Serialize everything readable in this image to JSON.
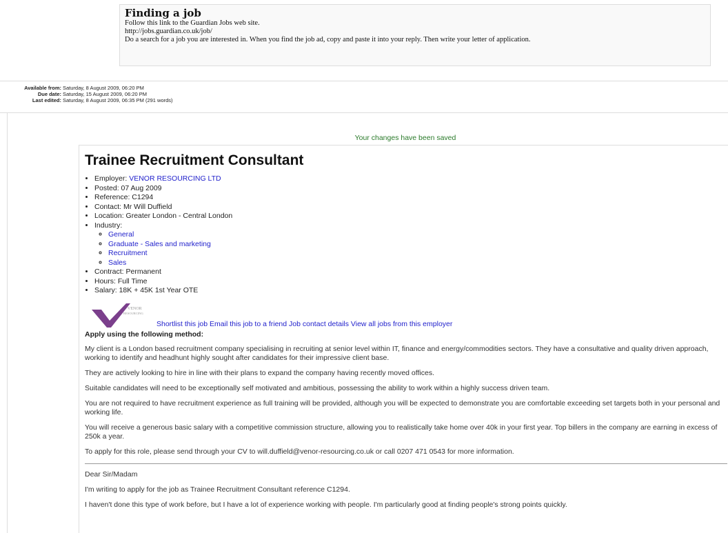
{
  "assignment": {
    "title": "Finding a job",
    "lines": [
      "Follow this link to the Guardian Jobs web site.",
      "http://jobs.guardian.co.uk/job/",
      "Do a search for a job you are interested in. When you find the job ad, copy and paste it into your reply. Then write your letter of application."
    ]
  },
  "dates": {
    "available_label": "Available from:",
    "available_value": "Saturday, 8 August 2009, 06:20 PM",
    "due_label": "Due date:",
    "due_value": "Saturday, 15 August 2009, 06:20 PM",
    "edited_label": "Last edited:",
    "edited_value": "Saturday, 8 August 2009, 06:35 PM (291 words)"
  },
  "status": {
    "saved": "Your changes have been saved"
  },
  "job": {
    "title": "Trainee Recruitment Consultant",
    "employer_label": "Employer: ",
    "employer": "VENOR RESOURCING LTD",
    "posted": "Posted: 07 Aug 2009",
    "reference": "Reference: C1294",
    "contact": "Contact: Mr Will Duffield",
    "location": "Location: Greater London - Central London",
    "industry_label": "Industry:",
    "industries": [
      "General",
      "Graduate - Sales and marketing",
      "Recruitment",
      "Sales"
    ],
    "contract": "Contract: Permanent",
    "hours": "Hours: Full Time",
    "salary": "Salary: 18K + 45K 1st Year OTE",
    "logo_text_1": "VENOR",
    "logo_text_2": "RESOURCING",
    "logo_color": "#7b3f8c",
    "links": [
      "Shortlist this job",
      "Email this job to a friend",
      "Job contact details",
      "View all jobs from this employer"
    ],
    "apply_heading": "Apply using the following method:",
    "paragraphs": [
      "My client is a London based recruitment company specialising in recruiting at senior level within IT, finance and energy/commodities sectors. They have a consultative and quality driven approach, working to identify and headhunt highly sought after candidates for their impressive client base.",
      "They are actively looking to hire in line with their plans to expand the company having recently moved offices.",
      "Suitable candidates will need to be exceptionally self motivated and ambitious, possessing the ability to work within a highly success driven team.",
      "You are not required to have recruitment experience as full training will be provided, although you will be expected to demonstrate you are comfortable exceeding set targets both in your personal and working life.",
      "You will receive a generous basic salary with a competitive commission structure, allowing you to realistically take home over 40k in your first year. Top billers in the company are earning in excess of 250k a year.",
      "To apply for this role, please send through your CV to will.duffield@venor-resourcing.co.uk or call 0207 471 0543 for more information."
    ]
  },
  "letter": {
    "salutation": "Dear Sir/Madam",
    "lines": [
      "I'm writing to apply for the job as Trainee Recruitment Consultant reference C1294.",
      "I haven't done this type of work before, but I have a lot of experience working with people. I'm particularly good at finding people's strong points quickly."
    ]
  }
}
